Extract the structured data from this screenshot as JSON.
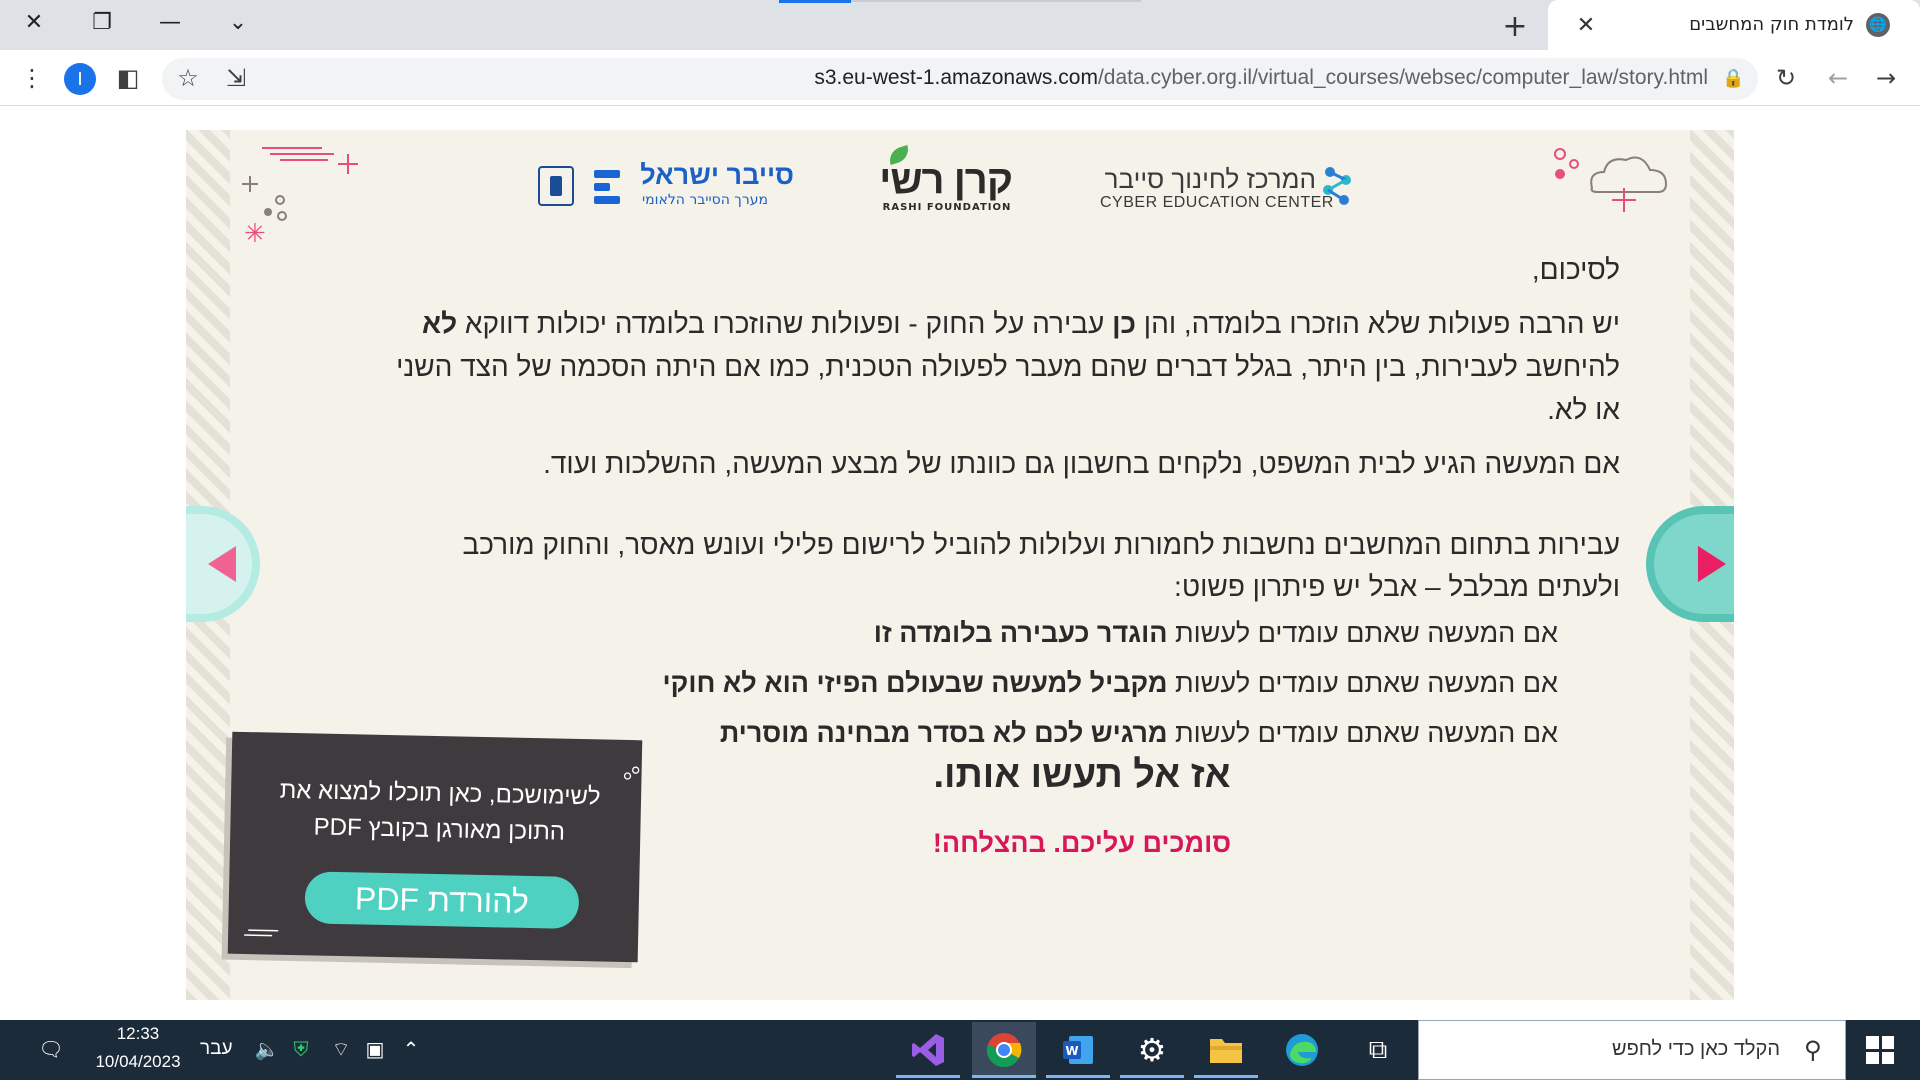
{
  "browser": {
    "tab_title": "לומדת חוק המחשבים",
    "url_domain": "s3.eu-west-1.amazonaws.com",
    "url_path": "/data.cyber.org.il/virtual_courses/websec/computer_law/story.html",
    "profile_initial": "I",
    "icons": [
      "close-icon",
      "restore-icon",
      "minimize-icon",
      "tab-search-icon",
      "new-tab-icon",
      "globe-icon",
      "menu-icon",
      "side-panel-icon",
      "bookmark-star-icon",
      "share-icon",
      "lock-icon",
      "reload-icon",
      "back-icon",
      "forward-icon"
    ]
  },
  "logos": {
    "cyber_israel": "סייבר ישראל",
    "cyber_israel_sub": "מערך הסייבר הלאומי",
    "rashi": "קרן רשי",
    "rashi_sub": "RASHI FOUNDATION",
    "cec_he": "המרכז לחינוך סייבר",
    "cec_en": "CYBER EDUCATION CENTER"
  },
  "content": {
    "heading": "לסיכום,",
    "p1_a": "יש הרבה פעולות שלא הוזכרו בלומדה, והן ",
    "p1_b": "כן",
    "p1_c": " עבירה על החוק - ופעולות שהוזכרו בלומדה יכולות דווקא ",
    "p1_d": "לא",
    "p1_e": " להיחשב לעבירות, בין היתר, בגלל דברים שהם מעבר לפעולה הטכנית, כמו אם היתה הסכמה של הצד השני או לא.",
    "p2": "אם המעשה הגיע לבית המשפט, נלקחים בחשבון גם כוונתו של מבצע המעשה, ההשלכות ועוד.",
    "p3": "עבירות בתחום המחשבים נחשבות לחמורות ועלולות להוביל לרישום פלילי ועונש מאסר, והחוק מורכב ולעתים מבלבל – אבל יש פיתרון פשוט:",
    "b_prefix": "אם המעשה שאתם עומדים לעשות ",
    "b1": "הוגדר כעבירה בלומדה זו",
    "b2": "מקביל למעשה שבעולם הפיזי הוא לא חוקי",
    "b3": "מרגיש לכם לא בסדר מבחינה מוסרית",
    "conclusion": "אז אל תעשו אותו.",
    "success": "סומכים עליכם. בהצלחה!"
  },
  "pdf": {
    "text": "לשימושכם, כאן תוכלו למצוא את התוכן מאורגן בקובץ PDF",
    "button": "להורדת PDF"
  },
  "taskbar": {
    "time": "12:33",
    "date": "10/04/2023",
    "lang": "עבר",
    "search_placeholder": "הקלד כאן כדי לחפש",
    "apps": [
      "visual-studio",
      "chrome",
      "word",
      "settings",
      "file-explorer",
      "edge",
      "task-view"
    ]
  },
  "colors": {
    "accent_teal": "#4fd1c1",
    "accent_pink": "#d8175b",
    "page_bg": "#f4f2e9",
    "card_bg": "#3f3a3d"
  }
}
